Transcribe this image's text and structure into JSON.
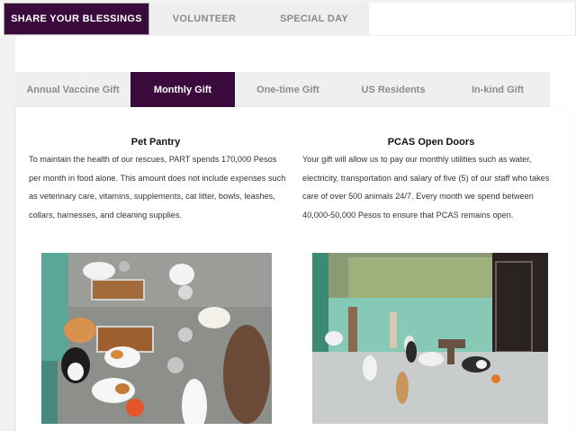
{
  "top_tabs": [
    {
      "label": "SHARE YOUR BLESSINGS",
      "active": true
    },
    {
      "label": "VOLUNTEER",
      "active": false
    },
    {
      "label": "SPECIAL DAY",
      "active": false
    }
  ],
  "sub_tabs": [
    {
      "label": "Annual Vaccine Gift",
      "active": false
    },
    {
      "label": "Monthly Gift",
      "active": true
    },
    {
      "label": "One-time Gift",
      "active": false
    },
    {
      "label": "US Residents",
      "active": false
    },
    {
      "label": "In-kind Gift",
      "active": false
    }
  ],
  "left_column": {
    "title": "Pet Pantry",
    "text": "To maintain the health of our rescues, PART spends 170,000 Pesos per month in food alone. This amount does not include expenses such as veterinary care, vitamins, supplements, cat litter, bowls, leashes, collars, harnesses, and cleaning supplies."
  },
  "right_column": {
    "title": "PCAS Open Doors",
    "text": "Your gift will allow us to pay our monthly utilities such as water, electricity, transportation and salary of five (5) of our staff who takes care of over 500 animals 24/7. Every month we spend between 40,000-50,000 Pesos to ensure that PCAS remains open."
  },
  "colors": {
    "accent": "#3b0a3d",
    "tab_bg": "#eeeeee",
    "tab_text": "#8a8a8a"
  }
}
